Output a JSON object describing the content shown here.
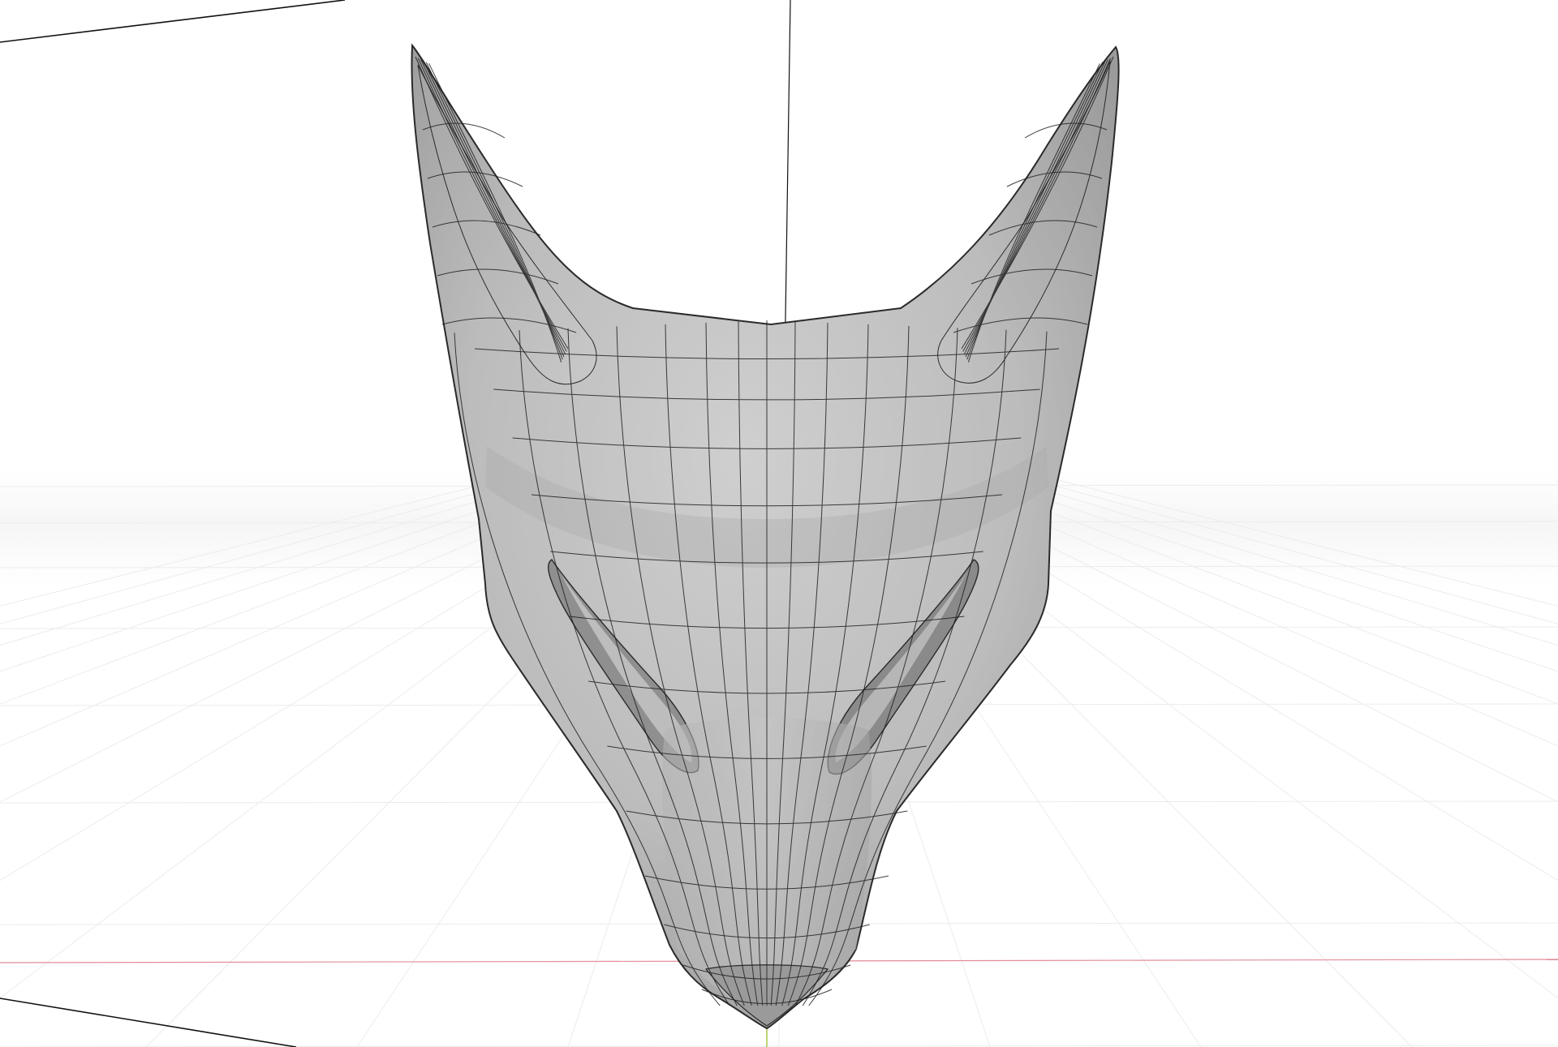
{
  "viewport": {
    "background_color": "#ffffff",
    "grid_color": "#ececec",
    "x_axis_color": "#e28c9a",
    "y_axis_color": "#9fc23a",
    "camera_line_color": "#111111"
  },
  "object": {
    "shape": "fox-mask",
    "display_mode": "solid-with-wireframe-overlay",
    "wireframe": true,
    "face_color": "#b9b9b9",
    "light_face_color": "#d3d3d3",
    "dark_face_color": "#8e8e8e",
    "wire_color": "#1f1f1f"
  }
}
